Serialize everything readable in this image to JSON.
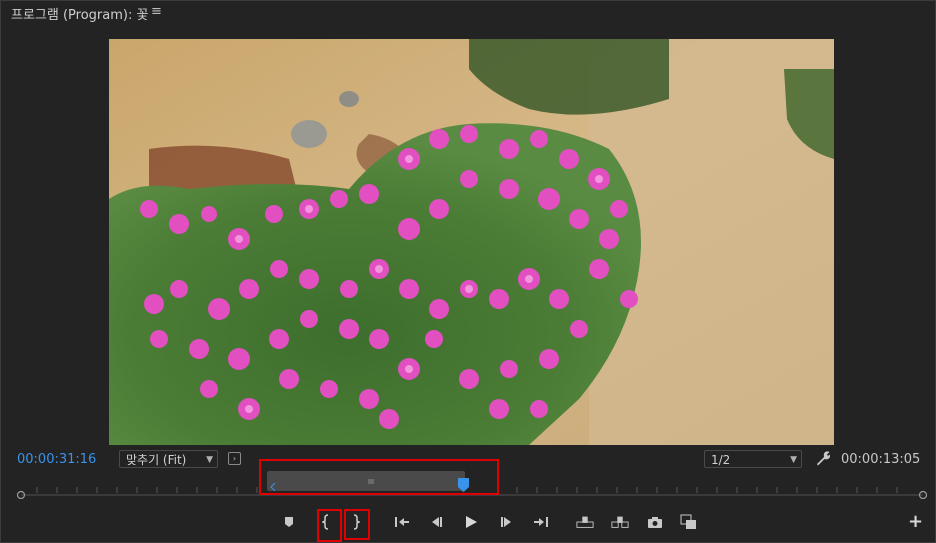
{
  "panel": {
    "title": "프로그램 (Program): 꽃",
    "menu_icon": "hamburger-icon"
  },
  "viewer": {
    "image_subject": "flower-bush-photo"
  },
  "timecode": {
    "current": "00:00:31:16",
    "duration": "00:00:13:05"
  },
  "zoom": {
    "selected": "맞추기 (Fit)"
  },
  "resolution": {
    "selected": "1/2"
  },
  "colors": {
    "accent": "#3a93ea",
    "highlight": "#e00000",
    "background": "#232323"
  },
  "controls": {
    "buttons": [
      "add-marker-icon",
      "mark-in-icon",
      "mark-out-icon",
      "go-to-in-icon",
      "step-back-icon",
      "play-icon",
      "step-forward-icon",
      "go-to-out-icon",
      "lift-icon",
      "extract-icon",
      "export-frame-icon",
      "compare-view-icon",
      "add-button-icon"
    ]
  }
}
